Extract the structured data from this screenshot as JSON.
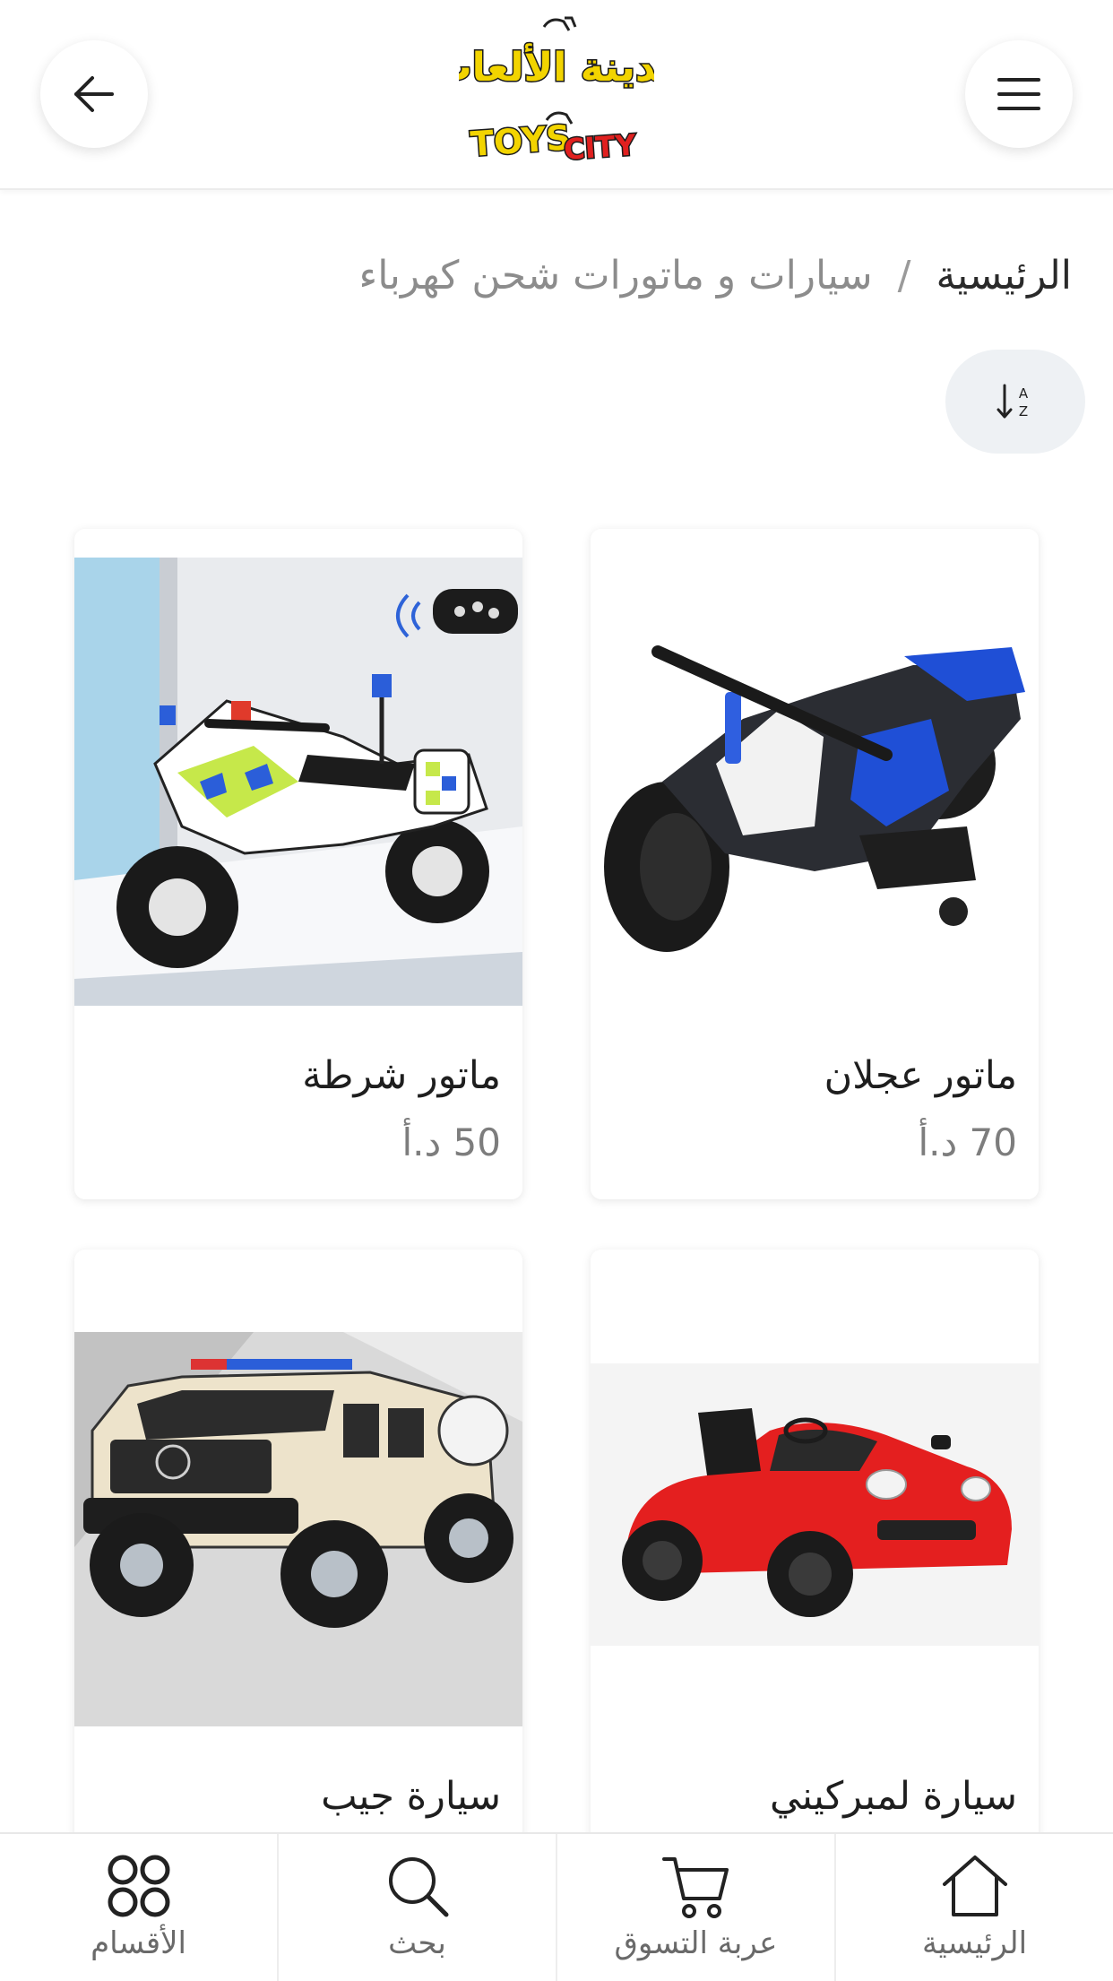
{
  "header": {
    "logo_text_ar": "مدينة الألعاب",
    "logo_text_en": "TOYS CITY",
    "back_icon": "arrow-left-icon",
    "menu_icon": "hamburger-menu-icon"
  },
  "breadcrumb": {
    "home": "الرئيسية",
    "separator": "/",
    "current": "سيارات و ماتورات شحن كهرباء"
  },
  "sort": {
    "icon": "sort-az-icon"
  },
  "products": [
    {
      "name": "ماتور عجلان",
      "price": "70 د.أ",
      "image": "sport-motorbike-blue-image"
    },
    {
      "name": "ماتور شرطة",
      "price": "50 د.أ",
      "image": "police-motorbike-image"
    },
    {
      "name": "سيارة لمبركيني",
      "price": "",
      "image": "red-sports-car-image"
    },
    {
      "name": "سيارة جيب",
      "price": "",
      "image": "un-jeep-image"
    }
  ],
  "bottom_nav": {
    "home": "الرئيسية",
    "cart": "عربة التسوق",
    "search": "بحث",
    "categories": "الأقسام"
  },
  "colors": {
    "sort_bg": "#eef1f4",
    "text_primary": "#1e1e1e",
    "text_muted": "#7d7d7d"
  }
}
